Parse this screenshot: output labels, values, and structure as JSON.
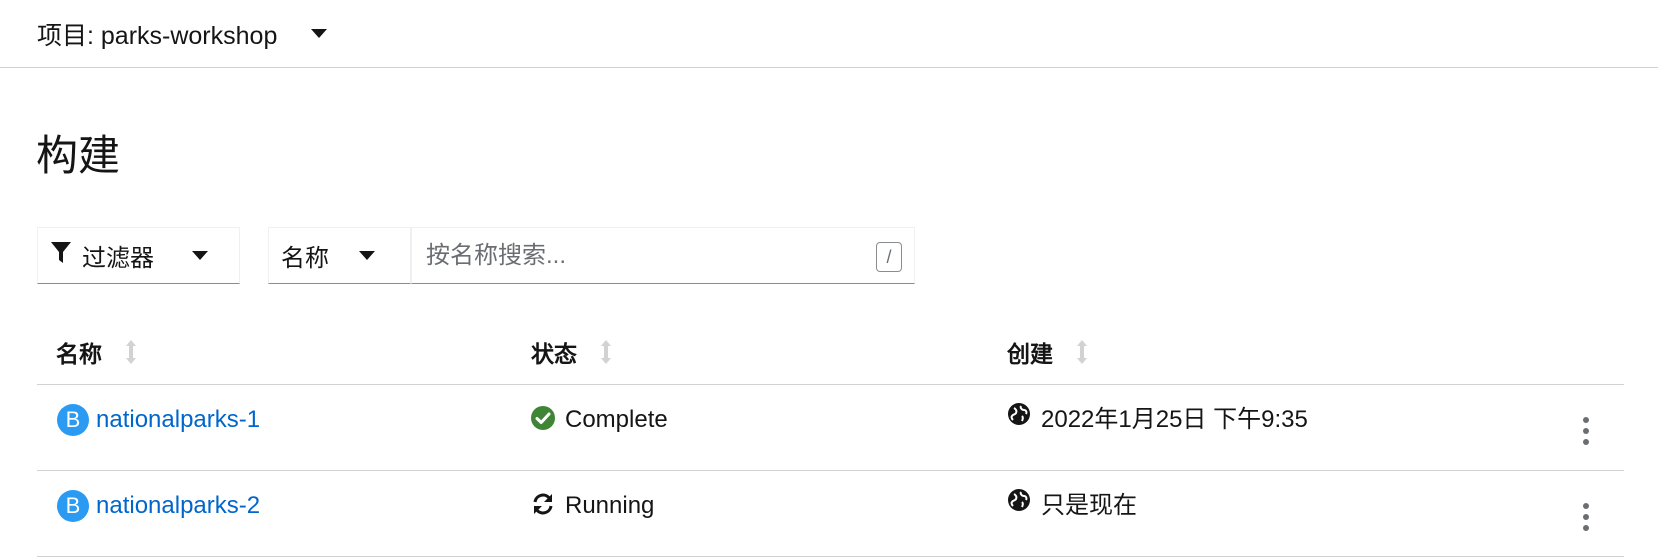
{
  "project_bar": {
    "label": "项目: parks-workshop"
  },
  "page": {
    "title": "构建"
  },
  "toolbar": {
    "filter_label": "过滤器",
    "attribute_label": "名称",
    "search_placeholder": "按名称搜索...",
    "search_value": "",
    "slash_hint": "/"
  },
  "table": {
    "columns": [
      "名称",
      "状态",
      "创建"
    ],
    "rows": [
      {
        "badge": "B",
        "name": "nationalparks-1",
        "status": "Complete",
        "status_icon": "check-circle-icon",
        "created": "2022年1月25日 下午9:35"
      },
      {
        "badge": "B",
        "name": "nationalparks-2",
        "status": "Running",
        "status_icon": "sync-icon",
        "created": "只是现在"
      }
    ]
  },
  "colors": {
    "link": "#0066cc",
    "badge": "#2b9af3",
    "success": "#3e8635",
    "border": "#d2d2d2"
  }
}
